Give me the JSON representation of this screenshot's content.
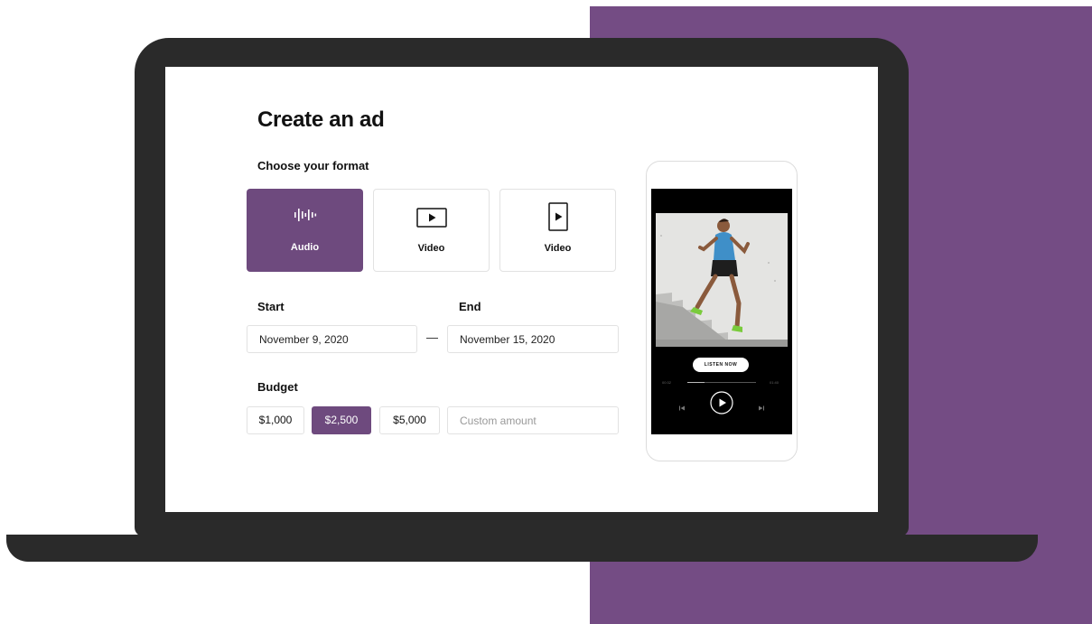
{
  "colors": {
    "accent": "#6e4a7e",
    "background_panel": "#744c84",
    "laptop": "#2a2a2a"
  },
  "form": {
    "title": "Create an ad",
    "format_label": "Choose your format",
    "formats": [
      {
        "label": "Audio",
        "icon": "audio-waveform-icon",
        "selected": true
      },
      {
        "label": "Video",
        "icon": "video-landscape-icon",
        "selected": false
      },
      {
        "label": "Video",
        "icon": "video-portrait-icon",
        "selected": false
      }
    ],
    "start_label": "Start",
    "end_label": "End",
    "start_value": "November 9, 2020",
    "end_value": "November 15, 2020",
    "dash": "—",
    "budget_label": "Budget",
    "budget_options": [
      {
        "label": "$1,000",
        "selected": false
      },
      {
        "label": "$2,500",
        "selected": true
      },
      {
        "label": "$5,000",
        "selected": false
      }
    ],
    "custom_placeholder": "Custom amount"
  },
  "preview": {
    "cta_label": "LISTEN NOW",
    "elapsed": "00:32",
    "duration": "01:40",
    "progress": 0.25
  }
}
